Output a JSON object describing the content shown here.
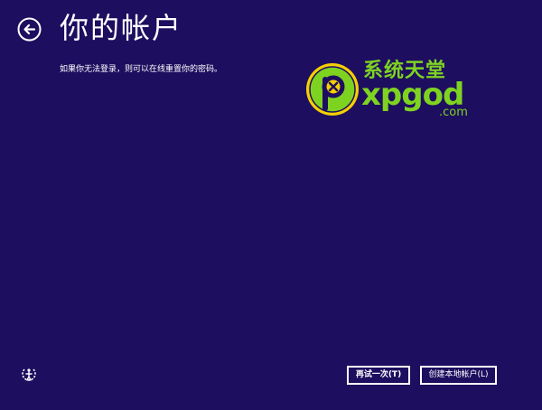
{
  "header": {
    "title": "你的帐户",
    "back_icon": "back-arrow-circle-icon"
  },
  "main": {
    "message": "如果你无法登录，则可以在线重置你的密码。"
  },
  "watermark": {
    "brand_cn": "系统天堂",
    "brand_en": "xpgod",
    "domain": ".com",
    "logo_letter": "P",
    "logo_icon": "xpgod-logo-icon"
  },
  "footer": {
    "ease_of_access_icon": "ease-of-access-icon",
    "retry_label": "再试一次(T)",
    "create_local_label": "创建本地帐户(L)"
  },
  "colors": {
    "background": "#1e0e5f",
    "text": "#ffffff",
    "watermark_green": "#7ed321",
    "watermark_yellow": "#f5d000"
  }
}
